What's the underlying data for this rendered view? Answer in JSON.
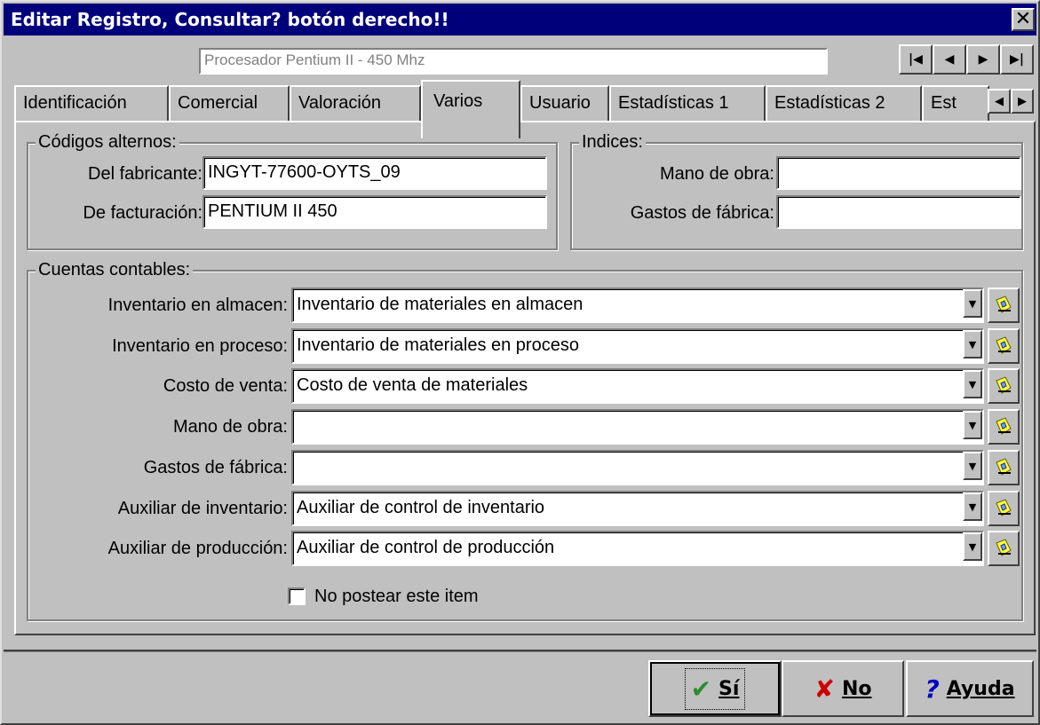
{
  "window": {
    "title": "Editar Registro, Consultar? botón derecho!!",
    "close_glyph": "✕"
  },
  "record": {
    "current": "Procesador Pentium II - 450 Mhz",
    "nav": [
      {
        "name": "first-record-button",
        "glyph": "|◀",
        "icon": "first-icon"
      },
      {
        "name": "prev-record-button",
        "glyph": "◀",
        "icon": "prev-icon"
      },
      {
        "name": "next-record-button",
        "glyph": "▶",
        "icon": "next-icon"
      },
      {
        "name": "last-record-button",
        "glyph": "▶|",
        "icon": "last-icon"
      }
    ]
  },
  "tabs": {
    "items": [
      {
        "label": "Identificación"
      },
      {
        "label": "Comercial"
      },
      {
        "label": "Valoración"
      },
      {
        "label": "Varios",
        "active": true
      },
      {
        "label": "Usuario"
      },
      {
        "label": "Estadísticas 1"
      },
      {
        "label": "Estadísticas 2"
      },
      {
        "label": "Est"
      }
    ],
    "scroll_left": "◀",
    "scroll_right": "▶"
  },
  "codigos": {
    "title": "Códigos alternos:",
    "fabricante_label": "Del fabricante:",
    "fabricante_value": "INGYT-77600-OYTS_09",
    "facturacion_label": "De facturación:",
    "facturacion_value": "PENTIUM II 450"
  },
  "indices": {
    "title": "Indices:",
    "mano_label": "Mano de obra:",
    "mano_value": "",
    "gastos_label": "Gastos de fábrica:",
    "gastos_value": ""
  },
  "cuentas": {
    "title": "Cuentas contables:",
    "rows": [
      {
        "label": "Inventario en almacen:",
        "value": "Inventario de materiales en almacen"
      },
      {
        "label": "Inventario en proceso:",
        "value": "Inventario de materiales en proceso"
      },
      {
        "label": "Costo de venta:",
        "value": "Costo de venta de materiales"
      },
      {
        "label": "Mano de obra:",
        "value": ""
      },
      {
        "label": "Gastos de fábrica:",
        "value": ""
      },
      {
        "label": "Auxiliar de inventario:",
        "value": "Auxiliar de control de inventario"
      },
      {
        "label": "Auxiliar de producción:",
        "value": "Auxiliar de control de producción"
      }
    ],
    "dropdown_glyph": "▼",
    "no_postear_label": "No postear este item",
    "no_postear_checked": false
  },
  "buttons": {
    "si_label": "Sí",
    "no_label": "No",
    "ayuda_label": "Ayuda",
    "si_glyph": "✔",
    "no_glyph": "✘",
    "ayuda_glyph": "?"
  },
  "colors": {
    "title_bar": "#00007b",
    "face": "#c0c0c0",
    "si_check": "#2e8b2e",
    "no_x": "#cc0000",
    "ayuda_q": "#0000c0"
  }
}
